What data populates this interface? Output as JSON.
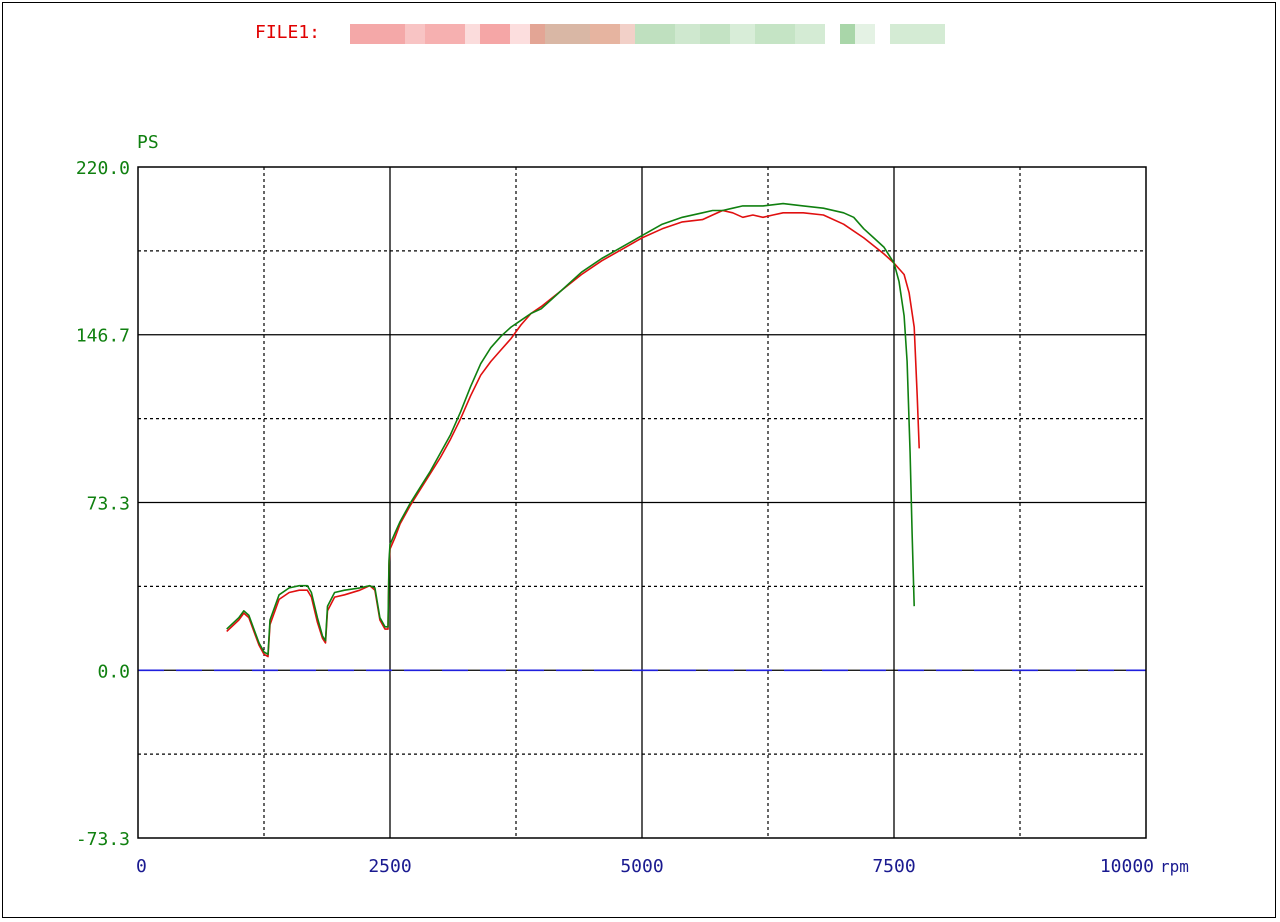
{
  "header": {
    "file_label": "FILE1:",
    "file_name_redacted": true
  },
  "chart_data": {
    "type": "line",
    "y_unit_label": "PS",
    "x_unit_label": "rpm",
    "xlim": [
      0,
      10000
    ],
    "ylim": [
      -73.3,
      220.0
    ],
    "x_ticks": [
      "0",
      "2500",
      "5000",
      "7500",
      "10000"
    ],
    "y_ticks": [
      "220.0",
      "146.7",
      "73.3",
      "0.0",
      "-73.3"
    ],
    "y_tick_values": [
      220.0,
      146.7,
      73.3,
      0.0,
      -73.3
    ],
    "x_tick_values": [
      0,
      2500,
      5000,
      7500,
      10000
    ],
    "grid": true,
    "zero_line": {
      "y": 0,
      "color": "#1f1fdd",
      "style": "dashed"
    },
    "series": [
      {
        "color": "#e01010",
        "points": [
          [
            880,
            17
          ],
          [
            1000,
            22
          ],
          [
            1050,
            25
          ],
          [
            1100,
            23
          ],
          [
            1150,
            17
          ],
          [
            1200,
            11
          ],
          [
            1250,
            7
          ],
          [
            1290,
            6
          ],
          [
            1310,
            20
          ],
          [
            1400,
            31
          ],
          [
            1500,
            34
          ],
          [
            1600,
            35
          ],
          [
            1680,
            35
          ],
          [
            1720,
            32
          ],
          [
            1780,
            21
          ],
          [
            1830,
            14
          ],
          [
            1860,
            12
          ],
          [
            1880,
            26
          ],
          [
            1950,
            32
          ],
          [
            2050,
            33
          ],
          [
            2200,
            35
          ],
          [
            2300,
            37
          ],
          [
            2350,
            35
          ],
          [
            2400,
            22
          ],
          [
            2450,
            18
          ],
          [
            2480,
            18
          ],
          [
            2490,
            46
          ],
          [
            2500,
            53
          ],
          [
            2550,
            58
          ],
          [
            2600,
            64
          ],
          [
            2700,
            72
          ],
          [
            2800,
            79
          ],
          [
            2900,
            86
          ],
          [
            3000,
            93
          ],
          [
            3100,
            101
          ],
          [
            3200,
            110
          ],
          [
            3300,
            120
          ],
          [
            3400,
            129
          ],
          [
            3500,
            135
          ],
          [
            3600,
            140
          ],
          [
            3700,
            145
          ],
          [
            3800,
            151
          ],
          [
            3900,
            156
          ],
          [
            4000,
            159
          ],
          [
            4200,
            166
          ],
          [
            4400,
            173
          ],
          [
            4600,
            179
          ],
          [
            4800,
            184
          ],
          [
            5000,
            189
          ],
          [
            5200,
            193
          ],
          [
            5400,
            196
          ],
          [
            5600,
            197
          ],
          [
            5700,
            199
          ],
          [
            5800,
            201
          ],
          [
            5900,
            200
          ],
          [
            6000,
            198
          ],
          [
            6100,
            199
          ],
          [
            6200,
            198
          ],
          [
            6300,
            199
          ],
          [
            6400,
            200
          ],
          [
            6600,
            200
          ],
          [
            6800,
            199
          ],
          [
            7000,
            195
          ],
          [
            7200,
            189
          ],
          [
            7400,
            182
          ],
          [
            7500,
            178
          ],
          [
            7600,
            173
          ],
          [
            7650,
            165
          ],
          [
            7700,
            150
          ],
          [
            7730,
            120
          ],
          [
            7750,
            97
          ]
        ]
      },
      {
        "color": "#108010",
        "points": [
          [
            880,
            18
          ],
          [
            1000,
            23
          ],
          [
            1050,
            26
          ],
          [
            1100,
            24
          ],
          [
            1150,
            18
          ],
          [
            1200,
            12
          ],
          [
            1250,
            8
          ],
          [
            1290,
            7
          ],
          [
            1310,
            22
          ],
          [
            1400,
            33
          ],
          [
            1500,
            36
          ],
          [
            1600,
            37
          ],
          [
            1680,
            37
          ],
          [
            1720,
            34
          ],
          [
            1780,
            23
          ],
          [
            1830,
            15
          ],
          [
            1860,
            13
          ],
          [
            1880,
            28
          ],
          [
            1950,
            34
          ],
          [
            2050,
            35
          ],
          [
            2200,
            36
          ],
          [
            2300,
            37
          ],
          [
            2350,
            36
          ],
          [
            2400,
            23
          ],
          [
            2450,
            19
          ],
          [
            2480,
            19
          ],
          [
            2490,
            48
          ],
          [
            2500,
            55
          ],
          [
            2550,
            60
          ],
          [
            2600,
            65
          ],
          [
            2700,
            73
          ],
          [
            2800,
            80
          ],
          [
            2900,
            87
          ],
          [
            3000,
            95
          ],
          [
            3100,
            103
          ],
          [
            3200,
            113
          ],
          [
            3300,
            124
          ],
          [
            3400,
            134
          ],
          [
            3500,
            141
          ],
          [
            3600,
            146
          ],
          [
            3700,
            150
          ],
          [
            3800,
            153
          ],
          [
            3900,
            156
          ],
          [
            4000,
            158
          ],
          [
            4200,
            166
          ],
          [
            4400,
            174
          ],
          [
            4600,
            180
          ],
          [
            4800,
            185
          ],
          [
            5000,
            190
          ],
          [
            5200,
            195
          ],
          [
            5400,
            198
          ],
          [
            5600,
            200
          ],
          [
            5700,
            201
          ],
          [
            5800,
            201
          ],
          [
            5900,
            202
          ],
          [
            6000,
            203
          ],
          [
            6200,
            203
          ],
          [
            6400,
            204
          ],
          [
            6600,
            203
          ],
          [
            6800,
            202
          ],
          [
            7000,
            200
          ],
          [
            7100,
            198
          ],
          [
            7200,
            193
          ],
          [
            7300,
            189
          ],
          [
            7400,
            185
          ],
          [
            7500,
            178
          ],
          [
            7550,
            170
          ],
          [
            7600,
            155
          ],
          [
            7630,
            135
          ],
          [
            7660,
            95
          ],
          [
            7680,
            60
          ],
          [
            7700,
            28
          ]
        ]
      }
    ]
  }
}
